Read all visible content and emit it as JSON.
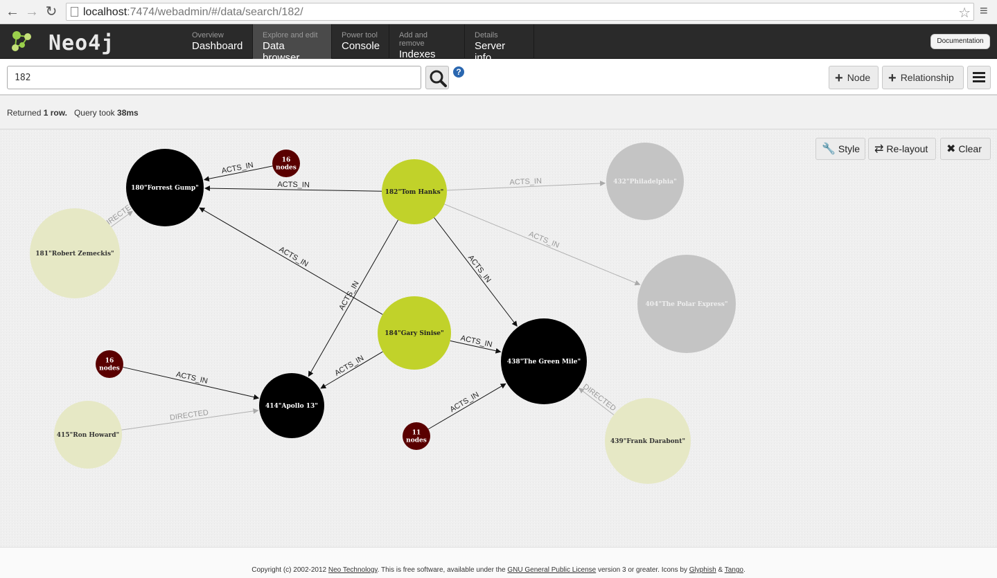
{
  "browser": {
    "url_host": "localhost",
    "url_rest": ":7474/webadmin/#/data/search/182/"
  },
  "app": {
    "logo_text": "Neo4j",
    "tabs": [
      {
        "sub": "Overview",
        "label": "Dashboard"
      },
      {
        "sub": "Explore and edit",
        "label": "Data browser"
      },
      {
        "sub": "Power tool",
        "label": "Console"
      },
      {
        "sub": "Add and remove",
        "label": "Indexes"
      },
      {
        "sub": "Details",
        "label": "Server info"
      }
    ],
    "documentation_label": "Documentation"
  },
  "search": {
    "value": "182",
    "help": "?"
  },
  "toolbar": {
    "node_label": "Node",
    "relationship_label": "Relationship"
  },
  "status": {
    "returned_prefix": "Returned",
    "rows": "1 row.",
    "query_prefix": "Query took",
    "time": "38ms"
  },
  "graph_controls": {
    "style_label": "Style",
    "relayout_label": "Re-layout",
    "clear_label": "Clear"
  },
  "graph": {
    "colors": {
      "movie": "#000000",
      "person": "#c1d22a",
      "faded_person": "#e6e8c5",
      "faded_movie": "#c4c4c4",
      "group": "#5a0000"
    },
    "nodes": [
      {
        "id": "n180",
        "label": "180\"Forrest Gump\"",
        "kind": "movie"
      },
      {
        "id": "n182",
        "label": "182\"Tom Hanks\"",
        "kind": "person"
      },
      {
        "id": "n181",
        "label": "181\"Robert Zemeckis\"",
        "kind": "faded_person"
      },
      {
        "id": "n432",
        "label": "432\"Philadelphia\"",
        "kind": "faded_movie"
      },
      {
        "id": "n404",
        "label": "404\"The Polar Express\"",
        "kind": "faded_movie"
      },
      {
        "id": "n184",
        "label": "184\"Gary Sinise\"",
        "kind": "person"
      },
      {
        "id": "n438",
        "label": "438\"The Green Mile\"",
        "kind": "movie"
      },
      {
        "id": "n414",
        "label": "414\"Apollo 13\"",
        "kind": "movie"
      },
      {
        "id": "n415",
        "label": "415\"Ron Howard\"",
        "kind": "faded_person"
      },
      {
        "id": "n439",
        "label": "439\"Frank Darabont\"",
        "kind": "faded_person"
      },
      {
        "id": "g1",
        "label": "16\nnodes",
        "kind": "group"
      },
      {
        "id": "g2",
        "label": "16\nnodes",
        "kind": "group"
      },
      {
        "id": "g3",
        "label": "11\nnodes",
        "kind": "group"
      }
    ],
    "edges": [
      {
        "from": "g1",
        "to": "n180",
        "label": "ACTS_IN",
        "faded": false
      },
      {
        "from": "n182",
        "to": "n180",
        "label": "ACTS_IN",
        "faded": false
      },
      {
        "from": "n182",
        "to": "n432",
        "label": "ACTS_IN",
        "faded": true
      },
      {
        "from": "n182",
        "to": "n404",
        "label": "ACTS_IN",
        "faded": true
      },
      {
        "from": "n182",
        "to": "n438",
        "label": "ACTS_IN",
        "faded": false
      },
      {
        "from": "n182",
        "to": "n414",
        "label": "ACTS_IN",
        "faded": false
      },
      {
        "from": "n181",
        "to": "n180",
        "label": "DIRECTED",
        "faded": true
      },
      {
        "from": "n184",
        "to": "n180",
        "label": "ACTS_IN",
        "faded": false
      },
      {
        "from": "n184",
        "to": "n438",
        "label": "ACTS_IN",
        "faded": false
      },
      {
        "from": "n184",
        "to": "n414",
        "label": "ACTS_IN",
        "faded": false
      },
      {
        "from": "g2",
        "to": "n414",
        "label": "ACTS_IN",
        "faded": false
      },
      {
        "from": "n415",
        "to": "n414",
        "label": "DIRECTED",
        "faded": true
      },
      {
        "from": "g3",
        "to": "n438",
        "label": "ACTS_IN",
        "faded": false
      },
      {
        "from": "n439",
        "to": "n438",
        "label": "DIRECTED",
        "faded": true
      }
    ]
  },
  "footer": {
    "copyright": "Copyright (c) 2002-2012",
    "company": "Neo Technology",
    "text1": ". This is free software, available under the",
    "license": "GNU General Public License",
    "text2": "version 3 or greater. Icons by",
    "glyphish": "Glyphish",
    "amp": "&",
    "tango": "Tango",
    "end": "."
  }
}
